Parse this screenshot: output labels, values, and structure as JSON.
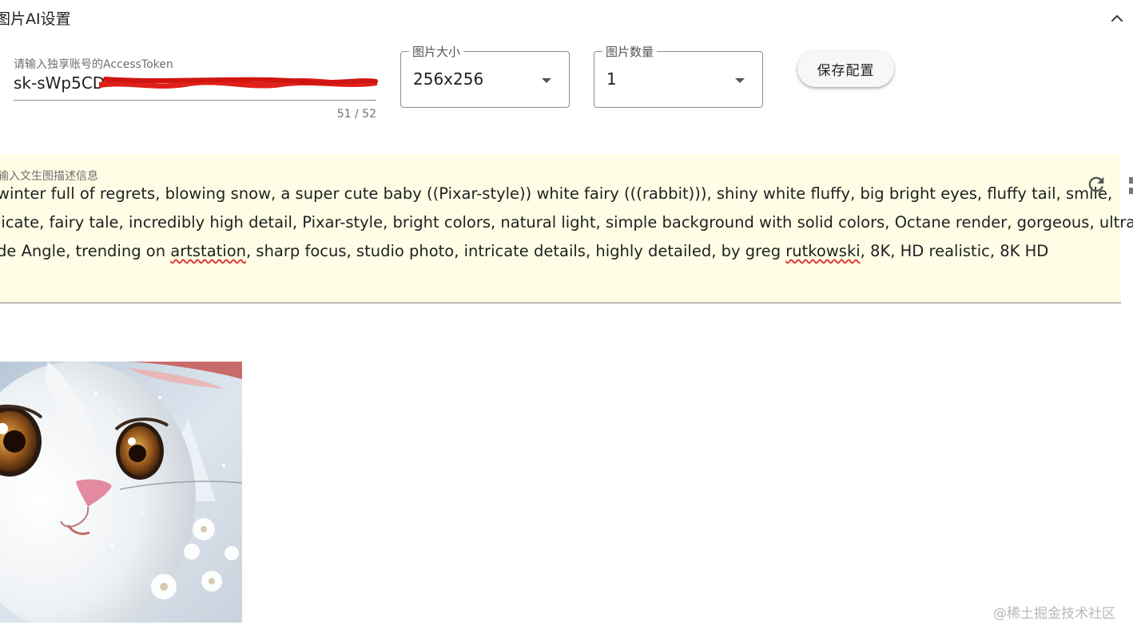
{
  "panel": {
    "title": "图片AI设置",
    "collapse_icon": "chevron-up-icon"
  },
  "token": {
    "label": "请输入独享账号的AccessToken",
    "value_visible": "sk-sWp5CD",
    "counter": "51 / 52",
    "redaction_color": "#e0201b"
  },
  "size_select": {
    "label": "图片大小",
    "value": "256x256"
  },
  "count_select": {
    "label": "图片数量",
    "value": "1"
  },
  "save_button": {
    "label": "保存配置"
  },
  "prompt": {
    "label": "输入文生图描述信息",
    "line1": "winter full of regrets, blowing snow, a super cute baby ((Pixar-style)) white fairy (((rabbit))), shiny white fluffy, big bright eyes, fluffy tail, smile,",
    "line2": "licate, fairy tale, incredibly high detail, Pixar-style, bright colors, natural light, simple background with solid colors, Octane render, gorgeous, ultra",
    "line3_a": "de Angle, trending on ",
    "line3_b": "artstation",
    "line3_c": ", sharp focus, studio photo, intricate details, highly detailed, by greg ",
    "line3_d": "rutkowski",
    "line3_e": ", 8K, HD realistic, 8K HD",
    "background_color": "#fefee6",
    "refresh_icon": "refresh-icon"
  },
  "result_image": {
    "subject": "white fairy rabbit illustration"
  },
  "watermark": {
    "text": "@稀土掘金技术社区"
  }
}
